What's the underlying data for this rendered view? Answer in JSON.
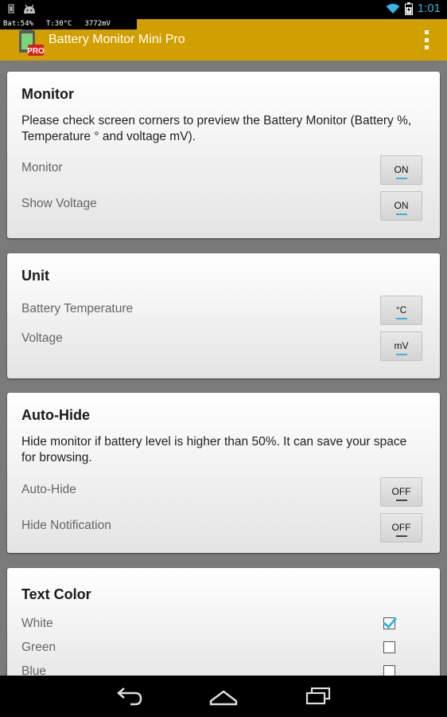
{
  "status_bar": {
    "time": "1:01"
  },
  "monitor_overlay": {
    "battery": "Bat:54%",
    "temperature": "T:30°C",
    "voltage": "3772mV"
  },
  "app": {
    "title": "Battery Monitor Mini Pro",
    "badge": "PRO"
  },
  "monitor": {
    "title": "Monitor",
    "description": "Please check screen corners to preview the Battery Monitor (Battery %, Temperature ° and voltage mV).",
    "rows": [
      {
        "label": "Monitor",
        "value": "ON"
      },
      {
        "label": "Show Voltage",
        "value": "ON"
      }
    ]
  },
  "unit": {
    "title": "Unit",
    "rows": [
      {
        "label": "Battery Temperature",
        "value": "°C"
      },
      {
        "label": "Voltage",
        "value": "mV"
      }
    ]
  },
  "autohide": {
    "title": "Auto-Hide",
    "description": "Hide monitor if battery level is higher than 50%. It can save your space for browsing.",
    "rows": [
      {
        "label": "Auto-Hide",
        "value": "OFF"
      },
      {
        "label": "Hide Notification",
        "value": "OFF"
      }
    ]
  },
  "text_color": {
    "title": "Text Color",
    "options": [
      {
        "label": "White",
        "checked": true
      },
      {
        "label": "Green",
        "checked": false
      },
      {
        "label": "Blue",
        "checked": false
      }
    ]
  },
  "colors": {
    "action_bar": "#d29f00",
    "accent": "#33b5e5",
    "status_bar": "#000000"
  },
  "icons": [
    "android-icon",
    "notification-icon",
    "wifi-icon",
    "battery-icon",
    "overflow-menu-icon",
    "back-icon",
    "home-icon",
    "recent-apps-icon"
  ]
}
